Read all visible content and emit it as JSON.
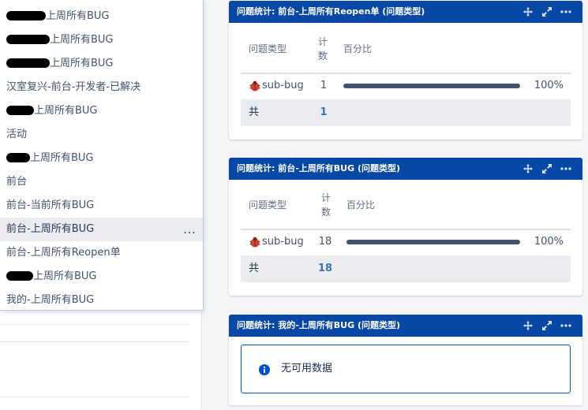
{
  "filter_list": {
    "items": [
      {
        "label": "上周所有BUG",
        "redacted": true,
        "active": false
      },
      {
        "label": "上周所有BUG",
        "redacted": true,
        "active": false
      },
      {
        "label": "上周所有BUG",
        "redacted": true,
        "active": false
      },
      {
        "label": "汉室复兴-前台-开发者-已解决",
        "redacted": false,
        "active": false
      },
      {
        "label": "上周所有BUG",
        "redacted": true,
        "active": false
      },
      {
        "label": "活动",
        "redacted": false,
        "active": false
      },
      {
        "label": "上周所有BUG",
        "redacted": true,
        "active": false
      },
      {
        "label": "前台",
        "redacted": false,
        "active": false
      },
      {
        "label": "前台-当前所有BUG",
        "redacted": false,
        "active": false
      },
      {
        "label": "前台-上周所有BUG",
        "redacted": false,
        "active": true
      },
      {
        "label": "前台-上周所有Reopen单",
        "redacted": false,
        "active": false
      },
      {
        "label": "上周所有BUG",
        "redacted": true,
        "active": false
      },
      {
        "label": "我的-上周所有BUG",
        "redacted": false,
        "active": false
      }
    ],
    "more_icon": "…"
  },
  "gadgets": [
    {
      "title": "问题统计: 前台-上周所有Reopen单 (问题类型)",
      "headers": {
        "type": "问题类型",
        "count": "计数",
        "percent": "百分比"
      },
      "rows": [
        {
          "type": "sub-bug",
          "count": "1",
          "percent_label": "100%",
          "fraction": 1.0
        }
      ],
      "total_label": "共",
      "total_count": "1"
    },
    {
      "title": "问题统计: 前台-上周所有BUG (问题类型)",
      "headers": {
        "type": "问题类型",
        "count": "计数",
        "percent": "百分比"
      },
      "rows": [
        {
          "type": "sub-bug",
          "count": "18",
          "percent_label": "100%",
          "fraction": 1.0
        }
      ],
      "total_label": "共",
      "total_count": "18"
    },
    {
      "title": "问题统计: 我的-上周所有BUG (问题类型)",
      "empty_message": "无可用数据"
    }
  ],
  "colors": {
    "header_bg": "#0747a6",
    "bar": "#42526e",
    "link": "#3b73af",
    "bug_red": "#d04437"
  },
  "icons": [
    "move-icon",
    "maximize-icon",
    "more-icon",
    "bug-icon",
    "info-icon"
  ]
}
